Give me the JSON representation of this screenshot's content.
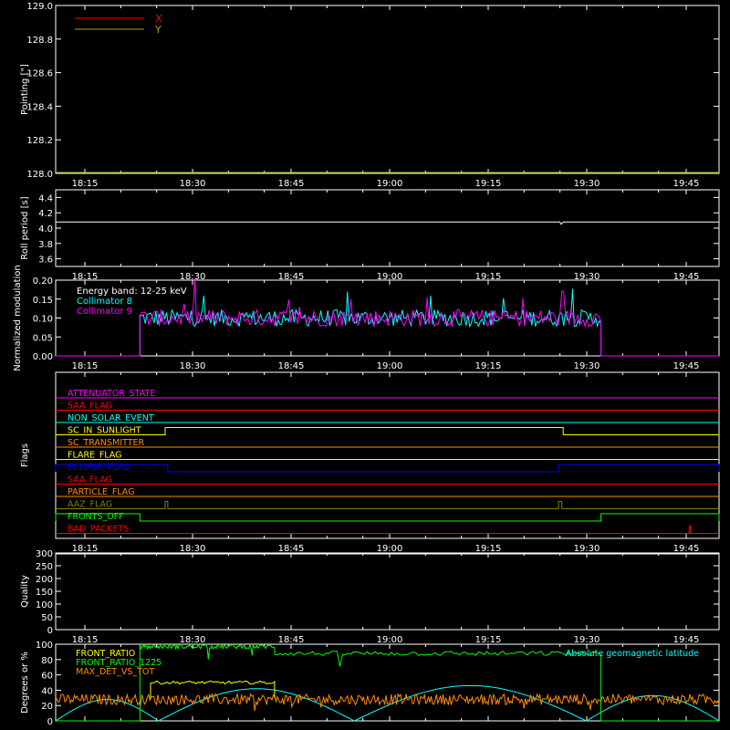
{
  "colors": {
    "background": "#000000",
    "axis": "#ffffff",
    "x_red": "#ff0000",
    "y_olive": "#a8a800",
    "cyan": "#00ffff",
    "magenta": "#ff00ff",
    "green": "#00ff00",
    "yellow": "#ffff00",
    "orange": "#ff8c00",
    "blue": "#0000ff",
    "olive": "#808000"
  },
  "chart_data": [
    {
      "type": "line",
      "ylabel": "Pointing [\"]",
      "ylim": [
        128.0,
        129.0
      ],
      "yticks": [
        "128.0",
        "128.2",
        "128.4",
        "128.6",
        "128.8",
        "129.0"
      ],
      "xlim": [
        "18:07",
        "19:52"
      ],
      "xticks": [
        "18:15",
        "18:30",
        "18:45",
        "19:00",
        "19:15",
        "19:30",
        "19:45"
      ],
      "legend": "top-left",
      "series": [
        {
          "name": "X",
          "color": "#ff0000",
          "points": [
            [
              0,
              128.0
            ],
            [
              1,
              128.0
            ]
          ]
        },
        {
          "name": "Y",
          "color": "#a8a800",
          "points": [
            [
              0,
              128.0
            ],
            [
              1,
              128.0
            ]
          ]
        }
      ]
    },
    {
      "type": "line",
      "ylabel": "Roll period [s]",
      "ylim": [
        3.5,
        4.5
      ],
      "yticks": [
        "3.6",
        "3.8",
        "4.0",
        "4.2",
        "4.4"
      ],
      "xticks": [
        "18:15",
        "18:30",
        "18:45",
        "19:00",
        "19:15",
        "19:30",
        "19:45"
      ],
      "series": [
        {
          "name": "",
          "color": "#ffffff",
          "points": [
            [
              0,
              4.08
            ],
            [
              0.76,
              4.08
            ],
            [
              0.762,
              4.05
            ],
            [
              0.765,
              4.08
            ],
            [
              1,
              4.08
            ]
          ]
        }
      ]
    },
    {
      "type": "line",
      "ylabel": "Normalized modulation",
      "ylim": [
        0.0,
        0.2
      ],
      "yticks": [
        "0.00",
        "0.05",
        "0.10",
        "0.15",
        "0.20"
      ],
      "xticks": [
        "18:15",
        "18:30",
        "18:45",
        "19:00",
        "19:15",
        "19:30",
        "19:45"
      ],
      "annotation": "Energy band: 12-25 keV",
      "legend": "top-left",
      "active_range": [
        0.127,
        0.822
      ],
      "series": [
        {
          "name": "Collimator 8",
          "color": "#00ffff",
          "mean": 0.1
        },
        {
          "name": "Collimator 9",
          "color": "#ff00ff",
          "mean": 0.1
        }
      ]
    },
    {
      "type": "line",
      "ylabel": "Flags",
      "xticks": [
        "18:15",
        "18:30",
        "18:45",
        "19:00",
        "19:15",
        "19:30",
        "19:45"
      ],
      "flags": [
        {
          "name": "ATTENUATOR_STATE",
          "color": "#ff00ff",
          "steps": []
        },
        {
          "name": "SAA_FLAG",
          "color": "#ff0000",
          "steps": []
        },
        {
          "name": "NON_SOLAR_EVENT",
          "color": "#00ffff",
          "steps": []
        },
        {
          "name": "SC_IN_SUNLIGHT",
          "color": "#ffff00",
          "steps": [
            [
              0.165,
              0.765
            ]
          ]
        },
        {
          "name": "SC_TRANSMITTER",
          "color": "#ff8c00",
          "steps": []
        },
        {
          "name": "FLARE_FLAG",
          "color": "#ffff00",
          "steps": []
        },
        {
          "name": "ECLIPSE_FLAG",
          "color": "#0000ff",
          "steps": [
            [
              0,
              0.169
            ],
            [
              0.758,
              1
            ]
          ]
        },
        {
          "name": "SAA_FLAG",
          "color": "#ff0000",
          "steps": []
        },
        {
          "name": "PARTICLE_FLAG",
          "color": "#ff8c00",
          "steps": []
        },
        {
          "name": "AAZ_FLAG",
          "color": "#808000",
          "steps": [
            [
              0.165,
              0.169
            ],
            [
              0.758,
              0.763
            ]
          ]
        },
        {
          "name": "FRONTS_OFF",
          "color": "#00ff00",
          "steps": [
            [
              0,
              0.127
            ],
            [
              0.822,
              1
            ]
          ]
        },
        {
          "name": "BAD_PACKETS",
          "color": "#ff0000",
          "steps": [
            [
              0.955,
              0.957
            ]
          ]
        }
      ]
    },
    {
      "type": "line",
      "ylabel": "Quality",
      "ylim": [
        0,
        300
      ],
      "yticks": [
        "0",
        "50",
        "100",
        "150",
        "200",
        "250",
        "300"
      ],
      "xticks": [
        "18:15",
        "18:30",
        "18:45",
        "19:00",
        "19:15",
        "19:30",
        "19:45"
      ],
      "series": [
        {
          "name": "",
          "color": "#ffffff",
          "points": [
            [
              0,
              300
            ],
            [
              1,
              300
            ]
          ]
        }
      ]
    },
    {
      "type": "line",
      "ylabel": "Degrees or %",
      "ylim": [
        0,
        100
      ],
      "yticks": [
        "0",
        "20",
        "40",
        "60",
        "80",
        "100"
      ],
      "legend": "top-left",
      "series": [
        {
          "name": "FRONT_RATIO",
          "color": "#ffff00",
          "segments": [
            [
              0.143,
              0.33,
              50
            ]
          ]
        },
        {
          "name": "FRONT_RATIO_1225",
          "color": "#00ff00",
          "segments": [
            [
              0.127,
              0.33,
              97
            ],
            [
              0.33,
              0.822,
              88
            ]
          ]
        },
        {
          "name": "MAX_DET_VS_TOT",
          "color": "#ff8c00",
          "mean": 28
        },
        {
          "name": "Absolute geomagnetic latitude",
          "color": "#00ffff",
          "arches": [
            [
              0.0,
              0.155,
              28
            ],
            [
              0.155,
              0.45,
              42
            ],
            [
              0.45,
              0.8,
              46
            ],
            [
              0.8,
              1.0,
              33
            ]
          ]
        }
      ]
    }
  ]
}
